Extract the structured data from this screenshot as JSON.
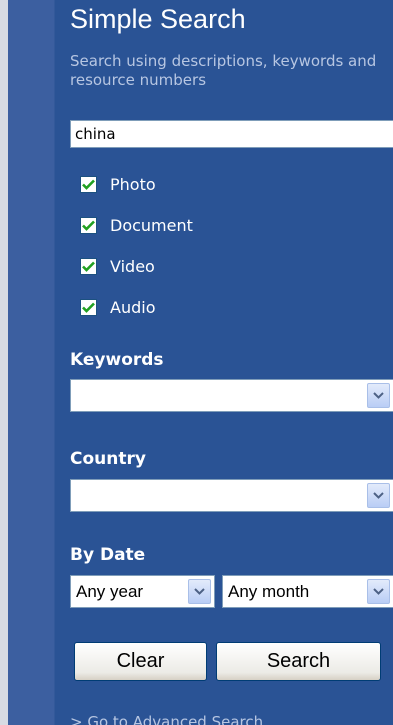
{
  "search": {
    "title": "Simple Search",
    "subtitle": "Search using descriptions, keywords and resource numbers",
    "query_value": "china"
  },
  "filters": [
    {
      "label": "Photo",
      "checked": true
    },
    {
      "label": "Document",
      "checked": true
    },
    {
      "label": "Video",
      "checked": true
    },
    {
      "label": "Audio",
      "checked": true
    }
  ],
  "keywords": {
    "label": "Keywords",
    "value": ""
  },
  "country": {
    "label": "Country",
    "value": ""
  },
  "by_date": {
    "label": "By Date",
    "year_value": "Any year",
    "month_value": "Any month"
  },
  "buttons": {
    "clear": "Clear",
    "search": "Search"
  },
  "advanced_link": "> Go to Advanced Search",
  "colors": {
    "panel": "#2a5395",
    "accent_check": "#21a121",
    "subtitle": "#b7c6e2"
  }
}
